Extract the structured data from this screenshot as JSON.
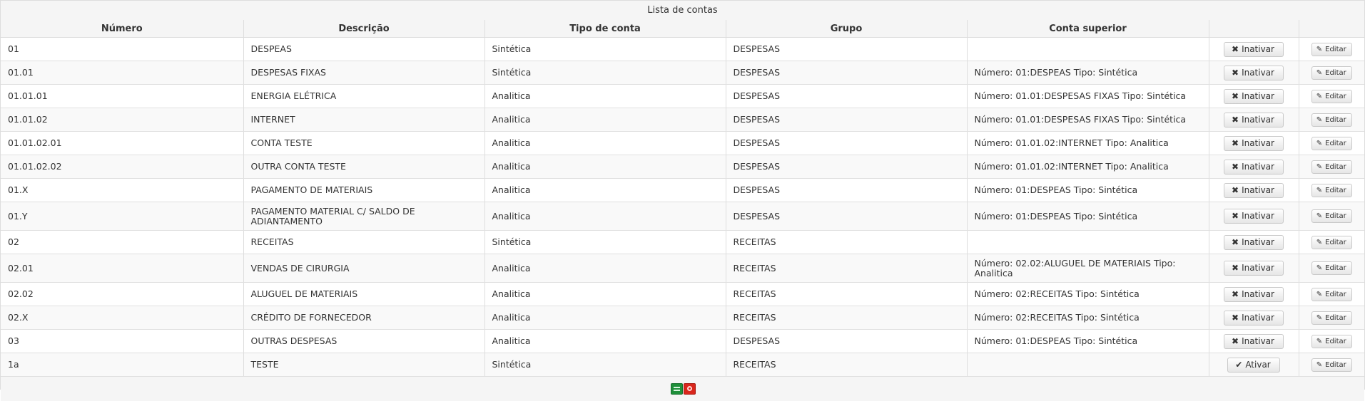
{
  "table": {
    "title": "Lista de contas",
    "headers": {
      "numero": "Número",
      "descricao": "Descrição",
      "tipo": "Tipo de conta",
      "grupo": "Grupo",
      "superior": "Conta superior"
    },
    "rows": [
      {
        "numero": "01",
        "descricao": "DESPEAS",
        "tipo": "Sintética",
        "grupo": "DESPESAS",
        "superior": "",
        "action": "Inativar",
        "edit": "Editar"
      },
      {
        "numero": "01.01",
        "descricao": "DESPESAS FIXAS",
        "tipo": "Sintética",
        "grupo": "DESPESAS",
        "superior": "Número: 01:DESPEAS Tipo: Sintética",
        "action": "Inativar",
        "edit": "Editar"
      },
      {
        "numero": "01.01.01",
        "descricao": "ENERGIA ELÉTRICA",
        "tipo": "Analitica",
        "grupo": "DESPESAS",
        "superior": "Número: 01.01:DESPESAS FIXAS Tipo: Sintética",
        "action": "Inativar",
        "edit": "Editar"
      },
      {
        "numero": "01.01.02",
        "descricao": "INTERNET",
        "tipo": "Analitica",
        "grupo": "DESPESAS",
        "superior": "Número: 01.01:DESPESAS FIXAS Tipo: Sintética",
        "action": "Inativar",
        "edit": "Editar"
      },
      {
        "numero": "01.01.02.01",
        "descricao": "CONTA TESTE",
        "tipo": "Analitica",
        "grupo": "DESPESAS",
        "superior": "Número: 01.01.02:INTERNET Tipo: Analitica",
        "action": "Inativar",
        "edit": "Editar"
      },
      {
        "numero": "01.01.02.02",
        "descricao": "OUTRA CONTA TESTE",
        "tipo": "Analitica",
        "grupo": "DESPESAS",
        "superior": "Número: 01.01.02:INTERNET Tipo: Analitica",
        "action": "Inativar",
        "edit": "Editar"
      },
      {
        "numero": "01.X",
        "descricao": "PAGAMENTO DE MATERIAIS",
        "tipo": "Analitica",
        "grupo": "DESPESAS",
        "superior": "Número: 01:DESPEAS Tipo: Sintética",
        "action": "Inativar",
        "edit": "Editar"
      },
      {
        "numero": "01.Y",
        "descricao": "PAGAMENTO MATERIAL C/ SALDO DE ADIANTAMENTO",
        "tipo": "Analitica",
        "grupo": "DESPESAS",
        "superior": "Número: 01:DESPEAS Tipo: Sintética",
        "action": "Inativar",
        "edit": "Editar"
      },
      {
        "numero": "02",
        "descricao": "RECEITAS",
        "tipo": "Sintética",
        "grupo": "RECEITAS",
        "superior": "",
        "action": "Inativar",
        "edit": "Editar"
      },
      {
        "numero": "02.01",
        "descricao": "VENDAS DE CIRURGIA",
        "tipo": "Analitica",
        "grupo": "RECEITAS",
        "superior": "Número: 02.02:ALUGUEL DE MATERIAIS Tipo: Analitica",
        "action": "Inativar",
        "edit": "Editar"
      },
      {
        "numero": "02.02",
        "descricao": "ALUGUEL DE MATERIAIS",
        "tipo": "Analitica",
        "grupo": "RECEITAS",
        "superior": "Número: 02:RECEITAS Tipo: Sintética",
        "action": "Inativar",
        "edit": "Editar"
      },
      {
        "numero": "02.X",
        "descricao": "CRÉDITO DE FORNECEDOR",
        "tipo": "Analitica",
        "grupo": "RECEITAS",
        "superior": "Número: 02:RECEITAS Tipo: Sintética",
        "action": "Inativar",
        "edit": "Editar"
      },
      {
        "numero": "03",
        "descricao": "OUTRAS DESPESAS",
        "tipo": "Analitica",
        "grupo": "DESPESAS",
        "superior": "Número: 01:DESPEAS Tipo: Sintética",
        "action": "Inativar",
        "edit": "Editar"
      },
      {
        "numero": "1a",
        "descricao": "TESTE",
        "tipo": "Sintética",
        "grupo": "RECEITAS",
        "superior": "",
        "action": "Ativar",
        "edit": "Editar"
      }
    ]
  },
  "icons": {
    "inativar": "times-icon",
    "ativar": "check-icon",
    "editar": "pencil-icon",
    "export_excel": "excel-export-icon",
    "export_pdf": "pdf-export-icon"
  },
  "colors": {
    "excel": "#1f8f3a",
    "pdf": "#d9261c"
  }
}
